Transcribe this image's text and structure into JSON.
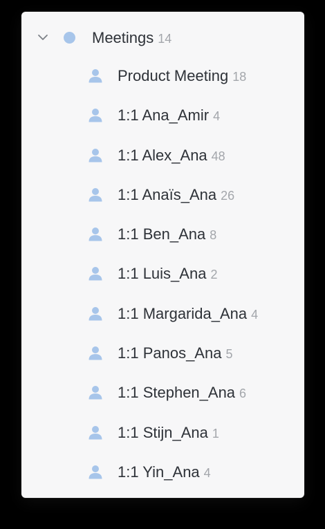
{
  "colors": {
    "background": "#000000",
    "panel": "#f7f7f8",
    "accent": "#a7c5ea",
    "text": "#2e3238",
    "count": "#a3a6ab"
  },
  "group": {
    "label": "Meetings",
    "count": "14",
    "expanded": true,
    "icon": "chevron-down-icon",
    "marker": "dot-icon"
  },
  "items": [
    {
      "label": "Product Meeting",
      "count": "18",
      "icon": "person-icon"
    },
    {
      "label": "1:1 Ana_Amir",
      "count": "4",
      "icon": "person-icon"
    },
    {
      "label": "1:1 Alex_Ana",
      "count": "48",
      "icon": "person-icon"
    },
    {
      "label": "1:1 Anaïs_Ana",
      "count": "26",
      "icon": "person-icon"
    },
    {
      "label": "1:1 Ben_Ana",
      "count": "8",
      "icon": "person-icon"
    },
    {
      "label": "1:1 Luis_Ana",
      "count": "2",
      "icon": "person-icon"
    },
    {
      "label": "1:1 Margarida_Ana",
      "count": "4",
      "icon": "person-icon"
    },
    {
      "label": "1:1 Panos_Ana",
      "count": "5",
      "icon": "person-icon"
    },
    {
      "label": "1:1 Stephen_Ana",
      "count": "6",
      "icon": "person-icon"
    },
    {
      "label": "1:1 Stijn_Ana",
      "count": "1",
      "icon": "person-icon"
    },
    {
      "label": "1:1 Yin_Ana",
      "count": "4",
      "icon": "person-icon"
    }
  ]
}
